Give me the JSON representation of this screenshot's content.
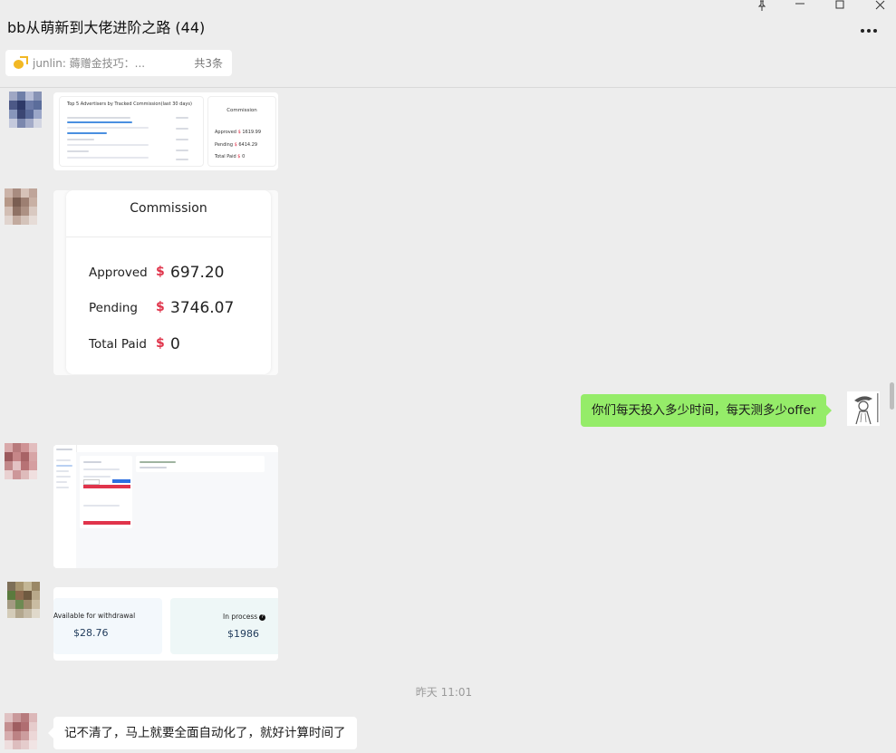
{
  "window": {
    "title": "bb从萌新到大佬进阶之路 (44)"
  },
  "pinned": {
    "text": "junlin: 薅赠金技巧：...",
    "count": "共3条"
  },
  "messages": {
    "card1": {
      "title": "Top 5 Advertisers by Tracked Commission(last 30 days)",
      "heading": "Commission",
      "rows": [
        {
          "label": "Approved",
          "value": "1619.99"
        },
        {
          "label": "Pending",
          "value": "6414.29"
        },
        {
          "label": "Total Paid",
          "value": "0"
        }
      ]
    },
    "card2": {
      "heading": "Commission",
      "currency": "$",
      "rows": [
        {
          "label": "Approved",
          "value": "697.20"
        },
        {
          "label": "Pending",
          "value": "3746.07"
        },
        {
          "label": "Total Paid",
          "value": "0"
        }
      ]
    },
    "me_bubble": "你们每天投入多少时间，每天测多少offer",
    "card4": {
      "available_label": "Available for withdrawal",
      "available_value": "$28.76",
      "process_label": "In process",
      "process_value": "$1986"
    },
    "timestamp": "昨天 11:01",
    "reply": "记不清了，马上就要全面自动化了，就好计算时间了"
  },
  "colors": {
    "accent_green": "#95ec69",
    "dollar_red": "#e0344b"
  }
}
